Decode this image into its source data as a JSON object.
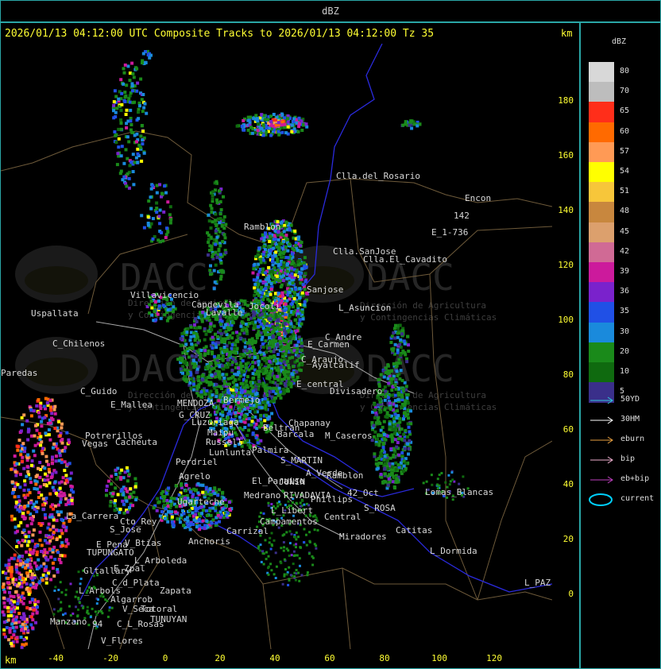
{
  "window": {
    "title": "dBZ"
  },
  "header": {
    "text": "2026/01/13 04:12:00 UTC Composite Tracks to 2026/01/13 04:12:00 Tz 35",
    "km_unit": "km",
    "km_unit_bottom": "km"
  },
  "axes": {
    "x_ticks": [
      "-40",
      "-20",
      "0",
      "20",
      "40",
      "60",
      "80",
      "100",
      "120"
    ],
    "y_ticks": [
      "180",
      "160",
      "140",
      "120",
      "100",
      "80",
      "60",
      "40",
      "20",
      "0"
    ]
  },
  "places": [
    "Clla.del_Rosario",
    "Encon",
    "142",
    "E_1-736",
    "Ramblon",
    "Clla.SanJose",
    "Clla.El_Cavadito",
    "Villavicencio",
    "Capdevila",
    "Lavalle",
    "Jocoli",
    "Sanjose",
    "L_Asuncion",
    "Uspallata",
    "E_Carmen",
    "C_Andre",
    "C_Chilenos",
    "C_Araujo",
    "Ayalcalif",
    "Paredas",
    "E_central",
    "Divisadero",
    "Bermejo",
    "C_Guido",
    "E_Mallea",
    "MENDOZA",
    "G_CRUZ",
    "Luzuriaga",
    "Maipu",
    "Russell",
    "Lunlunta",
    "Potrerillos",
    "Cacheuta",
    "Vegas",
    "Perdriel",
    "Agrelo",
    "Ugarteche",
    "Chapanay",
    "Beltran",
    "Palmira",
    "Barcala",
    "M_Caseros",
    "S_MARTIN",
    "A_Verde",
    "Ramblon",
    "JUNIN",
    "El_Paraiso",
    "RIVADAVIA",
    "Medrano",
    "Phillips",
    "42_Oct",
    "S_ROSA",
    "L_Libert",
    "Campamentos",
    "Central",
    "Lomas_Blancas",
    "La_Carrera",
    "Cto_Rey",
    "S_Jose",
    "Carrizal",
    "Catitas",
    "Anchoris",
    "E_Pena",
    "TUPUNGATO",
    "V_Btias",
    "Miradores",
    "L_Dormida",
    "L_Arboleda",
    "Gltallary",
    "E_Zpal",
    "L_Arbols",
    "C_d_Plata",
    "Zapata",
    "L_PAZ",
    "Algarrob",
    "V_Seca",
    "Manzano",
    "Totoral",
    "TUNUYAN",
    "C_L_Rosas",
    "V_Flores",
    "94"
  ],
  "watermark": {
    "logo_text": "DACC",
    "line1": "Dirección de Agricultura",
    "line2": "y Contingencias Climáticas"
  },
  "legend": {
    "title": "dBZ",
    "levels": [
      {
        "label": "80",
        "color": "#d8d8d8"
      },
      {
        "label": "70",
        "color": "#bdbdbd"
      },
      {
        "label": "65",
        "color": "#ff2e1a"
      },
      {
        "label": "60",
        "color": "#ff6a00"
      },
      {
        "label": "57",
        "color": "#ff9a55"
      },
      {
        "label": "54",
        "color": "#ffff00"
      },
      {
        "label": "51",
        "color": "#f7c63a"
      },
      {
        "label": "48",
        "color": "#c8873e"
      },
      {
        "label": "45",
        "color": "#dca06d"
      },
      {
        "label": "42",
        "color": "#d06a95"
      },
      {
        "label": "39",
        "color": "#cc1a9c"
      },
      {
        "label": "36",
        "color": "#7a22cc"
      },
      {
        "label": "35",
        "color": "#2050e6"
      },
      {
        "label": "30",
        "color": "#1a8adc"
      },
      {
        "label": "20",
        "color": "#1a8a1a"
      },
      {
        "label": "10",
        "color": "#0f6a0f"
      },
      {
        "label": "5",
        "color": "#3a2f8a"
      }
    ],
    "tracks": [
      {
        "label": "50YD",
        "color": "#30c8d8"
      },
      {
        "label": "30HM",
        "color": "#ffffff"
      },
      {
        "label": "eburn",
        "color": "#e8a040"
      },
      {
        "label": "bip",
        "color": "#f0b0d0"
      },
      {
        "label": "eb+bip",
        "color": "#c040c0"
      },
      {
        "label": "current",
        "color": "#00d0ff"
      }
    ]
  }
}
